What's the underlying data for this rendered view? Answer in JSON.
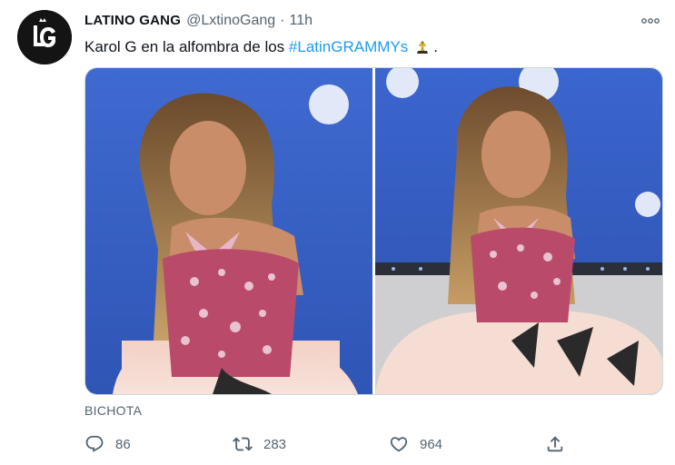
{
  "tweet": {
    "display_name": "LATINO GANG",
    "handle": "@LxtinoGang",
    "separator": "·",
    "time": "11h",
    "text_before": "Karol G en la alfombra de los ",
    "hashtag": "#LatinGRAMMYs",
    "text_after": ".",
    "emoji": "gramophone-trophy-icon",
    "avatar_letters": "LG",
    "caption": "BICHOTA"
  },
  "media": {
    "photos": [
      {
        "alt": "photo-1",
        "background": "#3a64c8"
      },
      {
        "alt": "photo-2",
        "background": "#3a64c8"
      }
    ]
  },
  "actions": {
    "replies": "86",
    "retweets": "283",
    "likes": "964",
    "reply_icon": "reply-icon",
    "retweet_icon": "retweet-icon",
    "like_icon": "heart-icon",
    "share_icon": "share-icon"
  },
  "colors": {
    "accent": "#1d9bf0",
    "muted": "#536471",
    "text": "#0f1419",
    "border": "#cfd9de"
  }
}
